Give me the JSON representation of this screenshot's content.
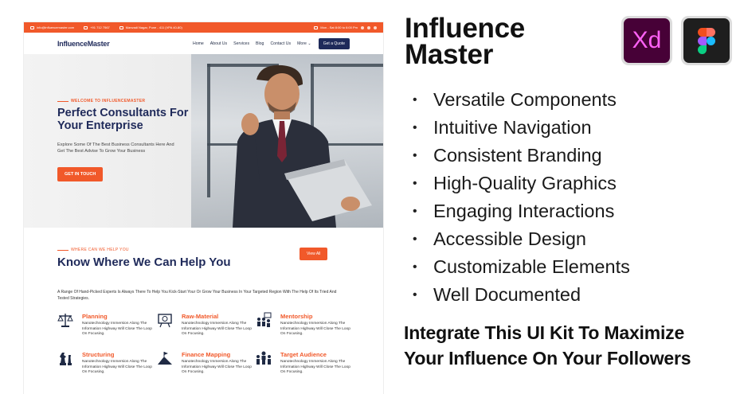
{
  "site": {
    "topbar": {
      "email": "info@influencemaster.com",
      "phone": "+91 712 7567",
      "address": "Marwadi Nagar, Pune - 411 (VPA 40-80)",
      "hours": "Mon - Sat 8:00 to 6:00 Pm"
    },
    "logo": "InfluenceMaster",
    "nav": [
      "Home",
      "About Us",
      "Services",
      "Blog",
      "Contact Us",
      "More"
    ],
    "nav_more_icon": "chevron-down-icon",
    "quote_button": "Get a Quote",
    "hero": {
      "tag": "WELCOME TO INFLUENCEMASTER",
      "title": "Perfect Consultants For Your Enterprise",
      "description": "Explore Some Of The Best Business Consultants Here And Get The Best Advise To Grow Your Business",
      "button": "GET IN TOUCH"
    },
    "help": {
      "tag": "WHERE CAN WE HELP YOU",
      "title": "Know Where We Can Help You",
      "view_all": "View All",
      "description": "A Range Of Hand-Picked Experts Is Always There To Help You Kick-Start Your Or Grow Your Business In Your Targeted Region With The Help Of Its Tried And Tested Strategies."
    },
    "services": [
      {
        "title": "Planning",
        "text": "Nanotechnology Immersion Along The Information Highway Will Close The Loop On Focusing.",
        "icon": "scales-icon"
      },
      {
        "title": "Raw-Material",
        "text": "Nanotechnology Immersion Along The Information Highway Will Close The Loop On Focusing.",
        "icon": "presentation-icon"
      },
      {
        "title": "Mentorship",
        "text": "Nanotechnology Immersion Along The Information Highway Will Close The Loop On Focusing.",
        "icon": "team-icon"
      },
      {
        "title": "Structuring",
        "text": "Nanotechnology Immersion Along The Information Highway Will Close The Loop On Focusing.",
        "icon": "chess-icon"
      },
      {
        "title": "Finance Mapping",
        "text": "Nanotechnology Immersion Along The Information Highway Will Close The Loop On Focusing.",
        "icon": "mountain-flag-icon"
      },
      {
        "title": "Target Audience",
        "text": "Nanotechnology Immersion Along The Information Highway Will Close The Loop On Focusing.",
        "icon": "audience-icon"
      }
    ]
  },
  "product": {
    "title_line1": "Influence",
    "title_line2": "Master",
    "xd_label": "Xd",
    "features": [
      "Versatile Components",
      "Intuitive Navigation",
      "Consistent Branding",
      "High-Quality Graphics",
      "Engaging Interactions",
      "Accessible Design",
      "Customizable Elements",
      "Well Documented"
    ],
    "bullet": "•",
    "cta_line1": "Integrate This UI Kit To Maximize",
    "cta_line2": "Your Influence On Your Followers"
  },
  "colors": {
    "accent": "#f1592a",
    "navy": "#1f2a5a",
    "xd_bg": "#470137",
    "xd_text": "#ff61f6"
  }
}
